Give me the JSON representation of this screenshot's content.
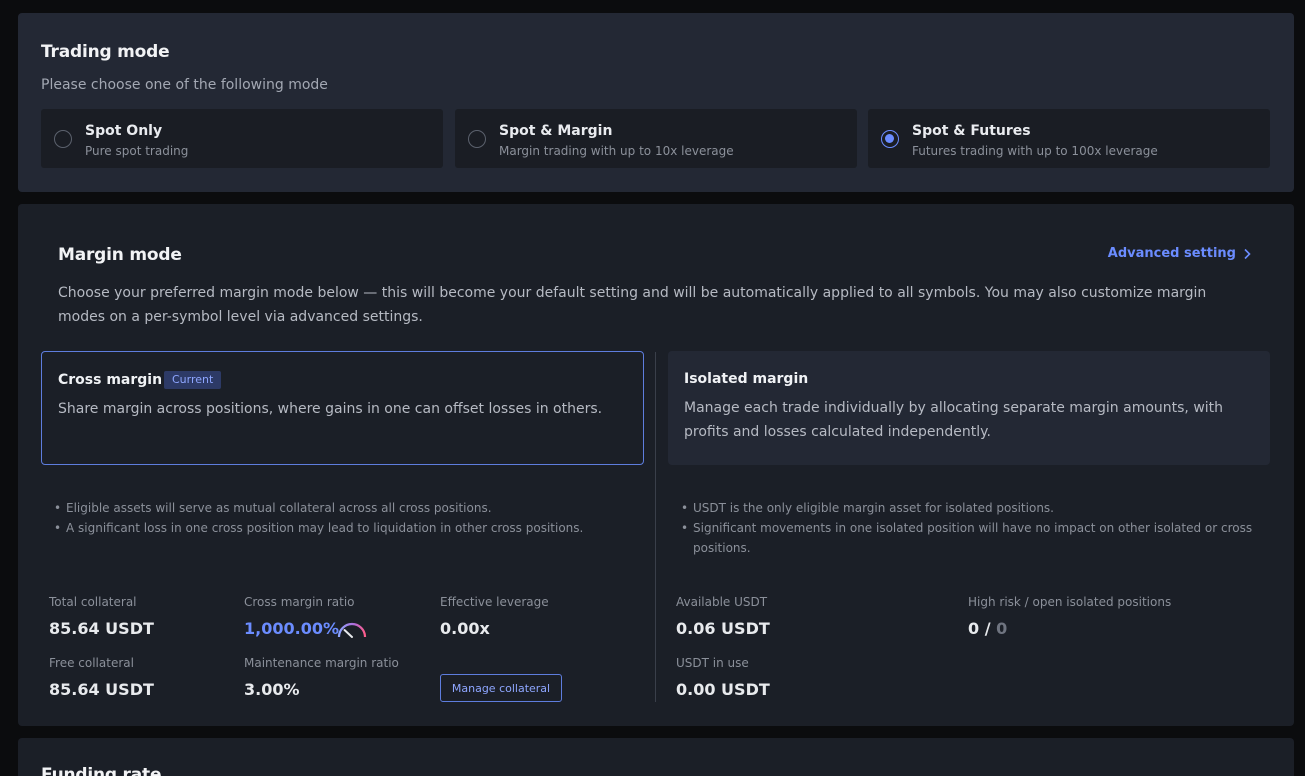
{
  "trading_mode": {
    "title": "Trading mode",
    "subtitle": "Please choose one of the following mode",
    "options": [
      {
        "title": "Spot Only",
        "desc": "Pure spot trading",
        "selected": false
      },
      {
        "title": "Spot & Margin",
        "desc": "Margin trading with up to 10x leverage",
        "selected": false
      },
      {
        "title": "Spot & Futures",
        "desc": "Futures trading with up to 100x leverage",
        "selected": true
      }
    ]
  },
  "margin_mode": {
    "title": "Margin mode",
    "advanced_label": "Advanced setting",
    "description": "Choose your preferred margin mode below — this will become your default setting and will be automatically applied to all symbols. You may also customize margin modes on a per-symbol level via advanced settings.",
    "cross": {
      "title": "Cross margin",
      "badge": "Current",
      "desc": "Share margin across positions, where gains in one can offset losses in others.",
      "bullets": [
        "Eligible assets will serve as mutual collateral across all cross positions.",
        "A significant loss in one cross position may lead to liquidation in other cross positions."
      ],
      "stats": {
        "total_collateral_label": "Total collateral",
        "total_collateral_value": "85.64 USDT",
        "cross_margin_ratio_label": "Cross margin ratio",
        "cross_margin_ratio_value": "1,000.00%",
        "effective_leverage_label": "Effective leverage",
        "effective_leverage_value": "0.00x",
        "free_collateral_label": "Free collateral",
        "free_collateral_value": "85.64 USDT",
        "maintenance_margin_ratio_label": "Maintenance margin ratio",
        "maintenance_margin_ratio_value": "3.00%"
      },
      "manage_button": "Manage collateral"
    },
    "isolated": {
      "title": "Isolated margin",
      "desc": "Manage each trade individually by allocating separate margin amounts, with profits and losses calculated independently.",
      "bullets": [
        "USDT is the only eligible margin asset for isolated positions.",
        "Significant movements in one isolated position will have no impact on other isolated or cross positions."
      ],
      "stats": {
        "available_usdt_label": "Available USDT",
        "available_usdt_value": "0.06 USDT",
        "high_risk_label": "High risk / open isolated positions",
        "high_risk_value": "0",
        "separator": "/",
        "open_positions_value": "0",
        "usdt_in_use_label": "USDT in use",
        "usdt_in_use_value": "0.00 USDT"
      }
    }
  },
  "funding_rate": {
    "title": "Funding rate"
  },
  "colors": {
    "accent": "#6b8cff",
    "panel": "#1b1f27",
    "background": "#0b0c0e"
  },
  "icons": {
    "advanced": "chevron-right-icon",
    "gauge": "gauge-icon"
  }
}
